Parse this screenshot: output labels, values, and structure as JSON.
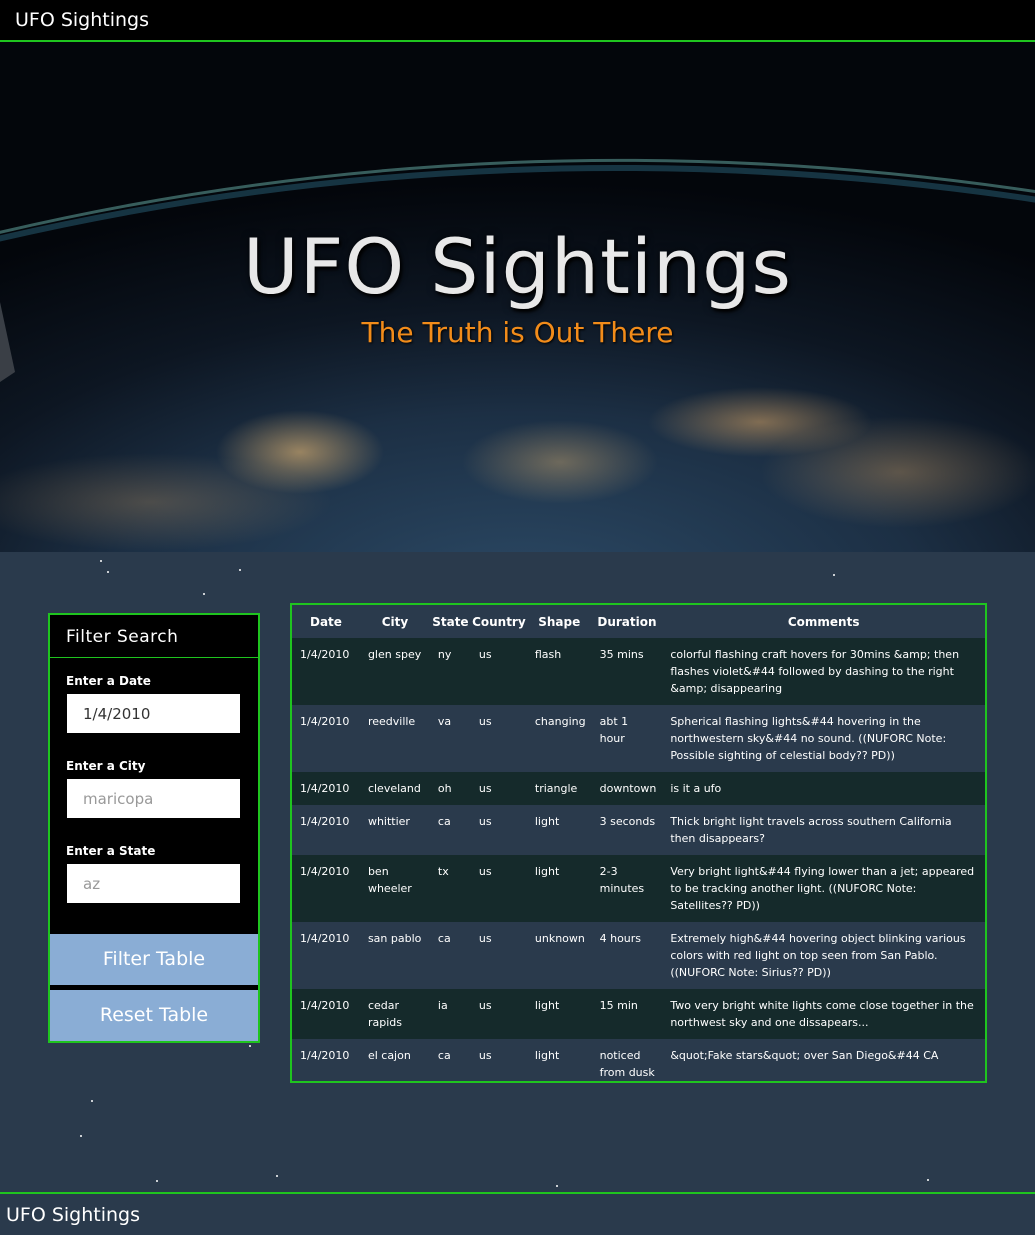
{
  "navbar": {
    "brand": "UFO Sightings"
  },
  "hero": {
    "title": "UFO Sightings",
    "subtitle": "The Truth is Out There"
  },
  "filter": {
    "heading": "Filter Search",
    "date_label": "Enter a Date",
    "date_value": "1/4/2010",
    "city_label": "Enter a City",
    "city_placeholder": "maricopa",
    "state_label": "Enter a State",
    "state_placeholder": "az",
    "filter_button": "Filter Table",
    "reset_button": "Reset Table"
  },
  "table": {
    "headers": [
      "Date",
      "City",
      "State",
      "Country",
      "Shape",
      "Duration",
      "Comments"
    ],
    "rows": [
      {
        "date": "1/4/2010",
        "city": "glen spey",
        "state": "ny",
        "country": "us",
        "shape": "flash",
        "duration": "35 mins",
        "comments": "colorful flashing craft hovers for 30mins &amp; then flashes violet&#44 followed by dashing to the right &amp; disappearing"
      },
      {
        "date": "1/4/2010",
        "city": "reedville",
        "state": "va",
        "country": "us",
        "shape": "changing",
        "duration": "abt 1 hour",
        "comments": "Spherical flashing lights&#44 hovering in the northwestern sky&#44 no sound. ((NUFORC Note: Possible sighting of celestial body?? PD))"
      },
      {
        "date": "1/4/2010",
        "city": "cleveland",
        "state": "oh",
        "country": "us",
        "shape": "triangle",
        "duration": "downtown",
        "comments": "is it a ufo"
      },
      {
        "date": "1/4/2010",
        "city": "whittier",
        "state": "ca",
        "country": "us",
        "shape": "light",
        "duration": "3 seconds",
        "comments": "Thick bright light travels across southern California then disappears?"
      },
      {
        "date": "1/4/2010",
        "city": "ben wheeler",
        "state": "tx",
        "country": "us",
        "shape": "light",
        "duration": "2-3 minutes",
        "comments": "Very bright light&#44 flying lower than a jet; appeared to be tracking another light. ((NUFORC Note: Satellites?? PD))"
      },
      {
        "date": "1/4/2010",
        "city": "san pablo",
        "state": "ca",
        "country": "us",
        "shape": "unknown",
        "duration": "4 hours",
        "comments": "Extremely high&#44 hovering object blinking various colors with red light on top seen from San Pablo. ((NUFORC Note: Sirius?? PD))"
      },
      {
        "date": "1/4/2010",
        "city": "cedar rapids",
        "state": "ia",
        "country": "us",
        "shape": "light",
        "duration": "15 min",
        "comments": "Two very bright white lights come close together in the northwest sky and one dissapears..."
      },
      {
        "date": "1/4/2010",
        "city": "el cajon",
        "state": "ca",
        "country": "us",
        "shape": "light",
        "duration": "noticed from dusk to dawn",
        "comments": "&quot;Fake stars&quot; over San Diego&#44 CA"
      }
    ]
  },
  "footer": {
    "text": "UFO Sightings"
  },
  "colors": {
    "accent_border": "#1fc41f",
    "subtitle": "#f28c1a",
    "button": "#8aadd5",
    "page_bg": "#2a3a4c"
  }
}
